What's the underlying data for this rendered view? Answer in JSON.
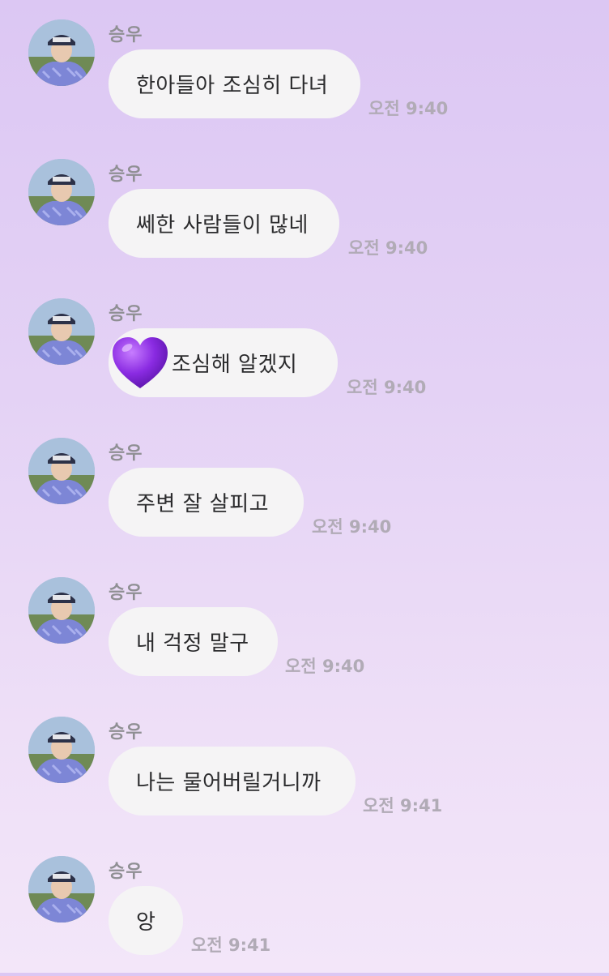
{
  "messages": [
    {
      "sender": "승우",
      "text": "한아들아 조심히 다녀",
      "time": "오전 9:40",
      "icon": ""
    },
    {
      "sender": "승우",
      "text": "쎄한 사람들이 많네",
      "time": "오전 9:40",
      "icon": ""
    },
    {
      "sender": "승우",
      "text": "조심해 알겠지",
      "time": "오전 9:40",
      "icon": "purple-heart-icon"
    },
    {
      "sender": "승우",
      "text": "주변 잘 살피고",
      "time": "오전 9:40",
      "icon": ""
    },
    {
      "sender": "승우",
      "text": "내 걱정 말구",
      "time": "오전 9:40",
      "icon": ""
    },
    {
      "sender": "승우",
      "text": "나는 물어버릴거니까",
      "time": "오전 9:41",
      "icon": ""
    },
    {
      "sender": "승우",
      "text": "앙",
      "time": "오전 9:41",
      "icon": ""
    }
  ],
  "colors": {
    "bubble": "#f5f4f5",
    "sender": "#8f8f93",
    "time": "#b1abb6",
    "heart": "#8a2be2"
  }
}
